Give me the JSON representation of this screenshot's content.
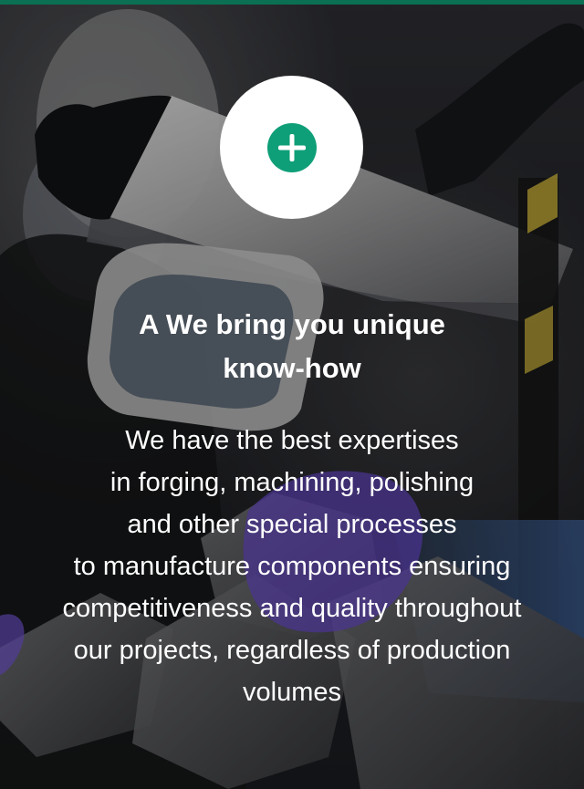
{
  "hero": {
    "accent_color": "#0f9f78",
    "plus_icon": "plus-icon",
    "headline_lines": [
      "A We bring you unique",
      "know-how"
    ],
    "body_lines": [
      "We have the best expertises",
      "in forging, machining, polishing",
      "and other special processes",
      "to manufacture  components ensuring",
      "competitiveness and quality throughout",
      "our projects, regardless of production",
      "volumes"
    ]
  }
}
